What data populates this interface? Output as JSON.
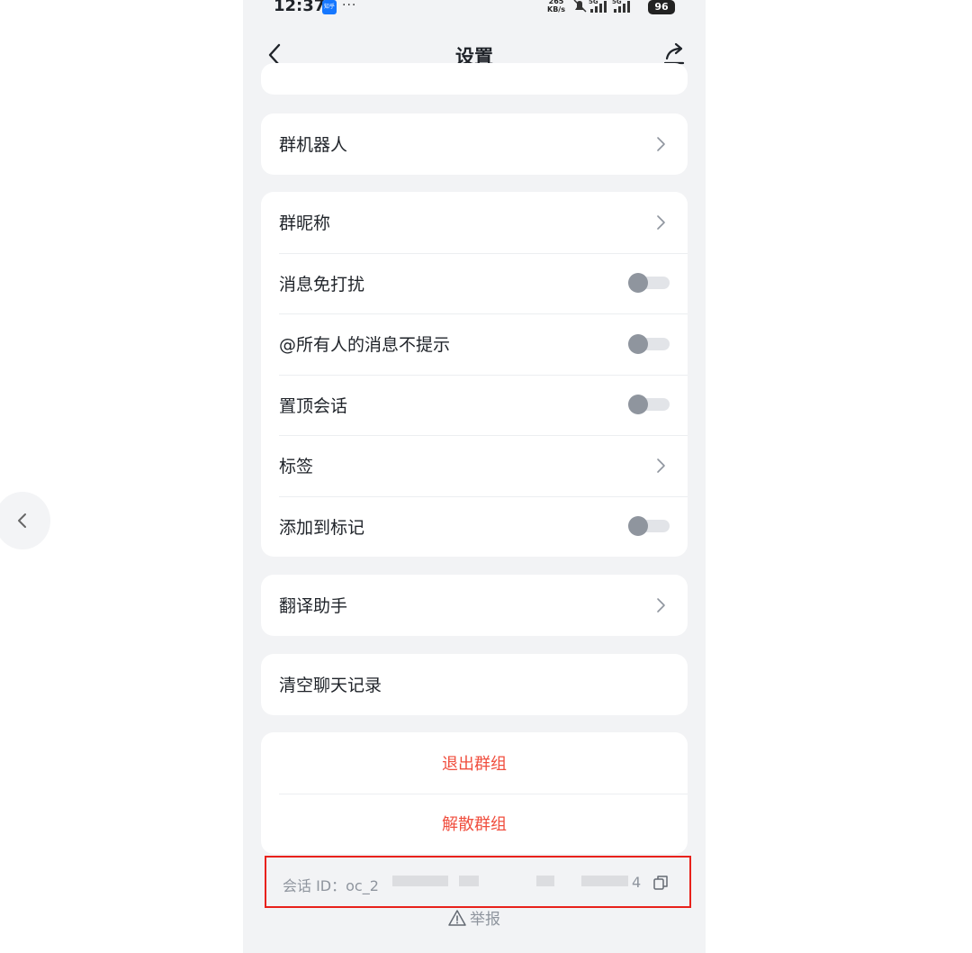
{
  "status_bar": {
    "time": "12:37",
    "app_badge": "知乎",
    "dots": "···",
    "speed_value": "265",
    "speed_unit": "KB/s",
    "network": "5G",
    "network2": "5G",
    "battery": "96"
  },
  "navbar": {
    "title": "设置"
  },
  "groups": {
    "bot": {
      "label": "群机器人"
    },
    "settings": [
      {
        "label": "群昵称",
        "control": "chevron"
      },
      {
        "label": "消息免打扰",
        "control": "toggle",
        "on": false
      },
      {
        "label": "@所有人的消息不提示",
        "control": "toggle",
        "on": false
      },
      {
        "label": "置顶会话",
        "control": "toggle",
        "on": false
      },
      {
        "label": "标签",
        "control": "chevron"
      },
      {
        "label": "添加到标记",
        "control": "toggle",
        "on": false
      }
    ],
    "translate": {
      "label": "翻译助手"
    },
    "clear": {
      "label": "清空聊天记录"
    },
    "exit": {
      "label": "退出群组"
    },
    "dissolve": {
      "label": "解散群组"
    }
  },
  "session": {
    "prefix": "会话 ID：oc_2",
    "suffix": "4"
  },
  "report": {
    "label": "举报"
  },
  "colors": {
    "danger": "#f04e3e",
    "highlight_box": "#e8211b",
    "background": "#f2f3f5"
  }
}
